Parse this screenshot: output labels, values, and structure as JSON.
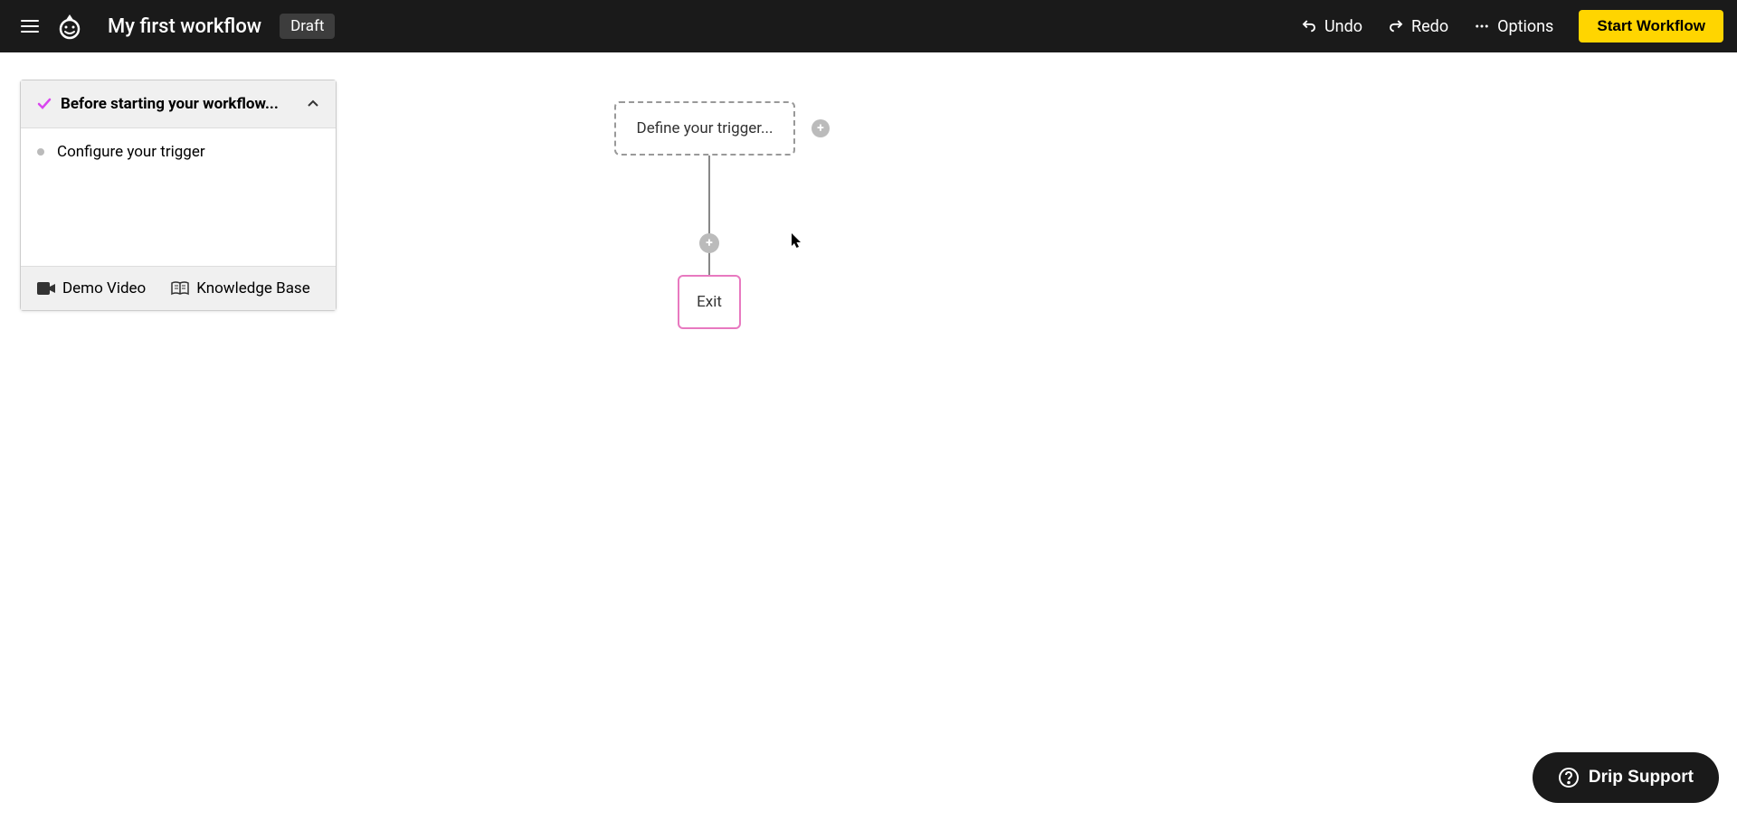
{
  "header": {
    "title": "My first workflow",
    "badge": "Draft",
    "undo": "Undo",
    "redo": "Redo",
    "options": "Options",
    "start": "Start Workflow"
  },
  "panel": {
    "title": "Before starting your workflow...",
    "items": [
      "Configure your trigger"
    ],
    "demo_video": "Demo Video",
    "knowledge_base": "Knowledge Base"
  },
  "canvas": {
    "trigger": "Define your trigger...",
    "exit": "Exit"
  },
  "support": {
    "label": "Drip Support"
  }
}
